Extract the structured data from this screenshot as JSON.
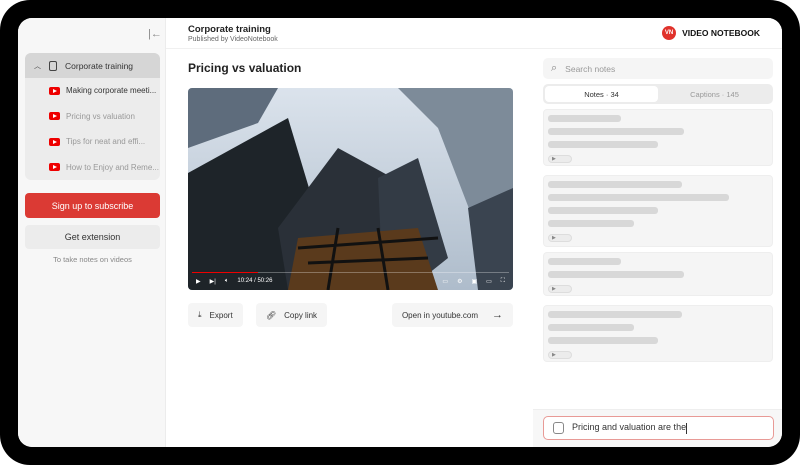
{
  "header": {
    "title": "Corporate training",
    "subtitle": "Published by VideoNotebook",
    "logo_text": "VIDEO NOTEBOOK",
    "logo_mark": "VN"
  },
  "sidebar": {
    "group_title": "Corporate training",
    "items": [
      {
        "label": "Making corporate meeti..."
      },
      {
        "label": "Pricing vs valuation"
      },
      {
        "label": "Tips for neat and effi..."
      },
      {
        "label": "How to Enjoy and Reme..."
      }
    ],
    "subscribe_label": "Sign up to subscribe",
    "extension_label": "Get extension",
    "extension_hint": "To take notes on videos"
  },
  "main": {
    "title": "Pricing vs valuation",
    "video": {
      "time": "10:24 / 50:26",
      "progress_percent": 20.7
    },
    "export_label": "Export",
    "copy_link_label": "Copy link",
    "open_youtube_label": "Open in youtube.com"
  },
  "notes": {
    "search_placeholder": "Search notes",
    "tabs": [
      {
        "label": "Notes · 34"
      },
      {
        "label": "Captions · 145"
      }
    ],
    "input_value": "Pricing and valuation are the"
  },
  "colors": {
    "accent": "#db3a34",
    "youtube": "#ee0000"
  }
}
